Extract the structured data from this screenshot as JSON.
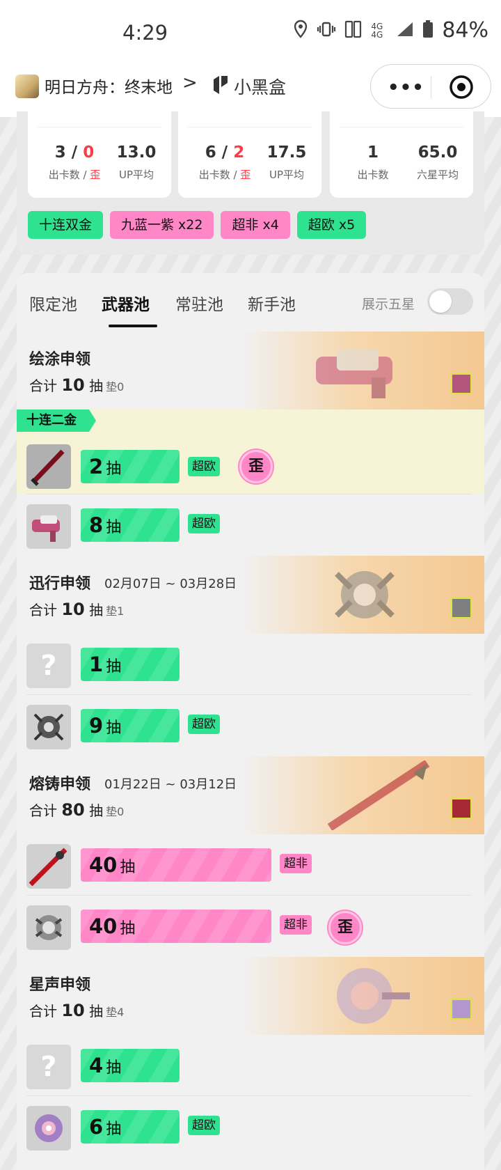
{
  "status_bar": {
    "time": "4:29",
    "network": "4G 4G",
    "battery": "84%"
  },
  "title_bar": {
    "game": "明日方舟：终末地",
    "chevron": ">",
    "brand": "小黑盒",
    "more": "•••"
  },
  "summary": {
    "cards": [
      {
        "left_value_a": "3",
        "left_sep": " / ",
        "left_value_b": "0",
        "left_label_a": "出卡数 / ",
        "left_label_b": "歪",
        "right_value": "13.0",
        "right_label": "UP平均"
      },
      {
        "left_value_a": "6",
        "left_sep": " / ",
        "left_value_b": "2",
        "left_label_a": "出卡数 / ",
        "left_label_b": "歪",
        "right_value": "17.5",
        "right_label": "UP平均"
      },
      {
        "left_value_a": "1",
        "left_label_a": "出卡数",
        "right_value": "65.0",
        "right_label": "六星平均"
      }
    ],
    "tags": [
      {
        "label": "十连双金",
        "color": "green"
      },
      {
        "label": "九蓝一紫 x22",
        "color": "pink"
      },
      {
        "label": "超非 x4",
        "color": "pink"
      },
      {
        "label": "超欧 x5",
        "color": "green"
      }
    ]
  },
  "tabs": [
    "限定池",
    "武器池",
    "常驻池",
    "新手池"
  ],
  "active_tab": "武器池",
  "toggle": {
    "label": "展示五星",
    "on": false
  },
  "pools": [
    {
      "title": "绘涂申领",
      "date": "",
      "total_prefix": "合计",
      "total": "10",
      "total_unit": "抽",
      "pad": "垫0",
      "ribbon": "十连二金",
      "rows": [
        {
          "count": "2",
          "unit": "抽",
          "color": "green",
          "badge": "超欧",
          "wai": "歪",
          "icon": "sword-icon",
          "highlight": true
        },
        {
          "count": "8",
          "unit": "抽",
          "color": "green",
          "badge": "超欧",
          "wai": "",
          "icon": "pink-launcher-icon",
          "highlight": false
        }
      ]
    },
    {
      "title": "迅行申领",
      "date": "02月07日 ~ 03月28日",
      "total_prefix": "合计",
      "total": "10",
      "total_unit": "抽",
      "pad": "垫1",
      "rows": [
        {
          "count": "1",
          "unit": "抽",
          "color": "green",
          "badge": "",
          "wai": "",
          "icon": "question-mark-icon",
          "highlight": false
        },
        {
          "count": "9",
          "unit": "抽",
          "color": "green",
          "badge": "超欧",
          "wai": "",
          "icon": "gauntlet-icon",
          "highlight": false
        }
      ]
    },
    {
      "title": "熔铸申领",
      "date": "01月22日 ~ 03月12日",
      "total_prefix": "合计",
      "total": "80",
      "total_unit": "抽",
      "pad": "垫0",
      "rows": [
        {
          "count": "40",
          "unit": "抽",
          "color": "pink",
          "badge": "超非",
          "wai": "",
          "icon": "red-spear-icon",
          "highlight": false
        },
        {
          "count": "40",
          "unit": "抽",
          "color": "pink",
          "badge": "超非",
          "wai": "歪",
          "icon": "silver-gauntlet-icon",
          "highlight": false
        }
      ]
    },
    {
      "title": "星声申领",
      "date": "",
      "total_prefix": "合计",
      "total": "10",
      "total_unit": "抽",
      "pad": "垫4",
      "rows": [
        {
          "count": "4",
          "unit": "抽",
          "color": "green",
          "badge": "",
          "wai": "",
          "icon": "question-mark-icon",
          "highlight": false
        },
        {
          "count": "6",
          "unit": "抽",
          "color": "green",
          "badge": "超欧",
          "wai": "",
          "icon": "crystal-orb-icon",
          "highlight": false
        }
      ]
    }
  ]
}
